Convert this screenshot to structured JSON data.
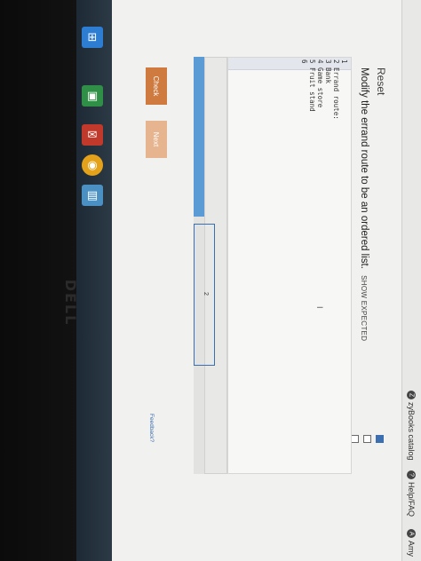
{
  "taskbar": {
    "icons": [
      {
        "name": "windows-start-icon",
        "glyph": "⊞",
        "color": "#2d7dd2"
      },
      {
        "name": "store-app-icon",
        "glyph": "▣",
        "color": "#2f8f46"
      },
      {
        "name": "mail-app-icon",
        "glyph": "✉",
        "color": "#c0392b"
      },
      {
        "name": "chrome-icon",
        "glyph": "◉",
        "color": "#e3a21a"
      },
      {
        "name": "folder-icon",
        "glyph": "▤",
        "color": "#4a90c2"
      }
    ]
  },
  "bookmarks": [
    {
      "label": "zyBooks catalog",
      "icon": "Z"
    },
    {
      "label": "Help/FAQ",
      "icon": "?"
    },
    {
      "label": "Amy",
      "icon": "A"
    }
  ],
  "panel": {
    "reset_label": "Reset",
    "instructions": "Modify the errand route to be an ordered list.",
    "show_expected": "SHOW EXPECTED",
    "code_lines": [
      {
        "num": "1",
        "text": ""
      },
      {
        "num": "2",
        "text": "Errand route:"
      },
      {
        "num": "3",
        "text": "Bank"
      },
      {
        "num": "4",
        "text": "Game store"
      },
      {
        "num": "5",
        "text": "Fruit stand"
      },
      {
        "num": "6",
        "text": ""
      }
    ],
    "cursor_glyph": "I",
    "active_box_number": "2",
    "check_label": "Check",
    "next_label": "Next",
    "feedback_label": "Feedback?"
  },
  "logo_text": "DELL"
}
